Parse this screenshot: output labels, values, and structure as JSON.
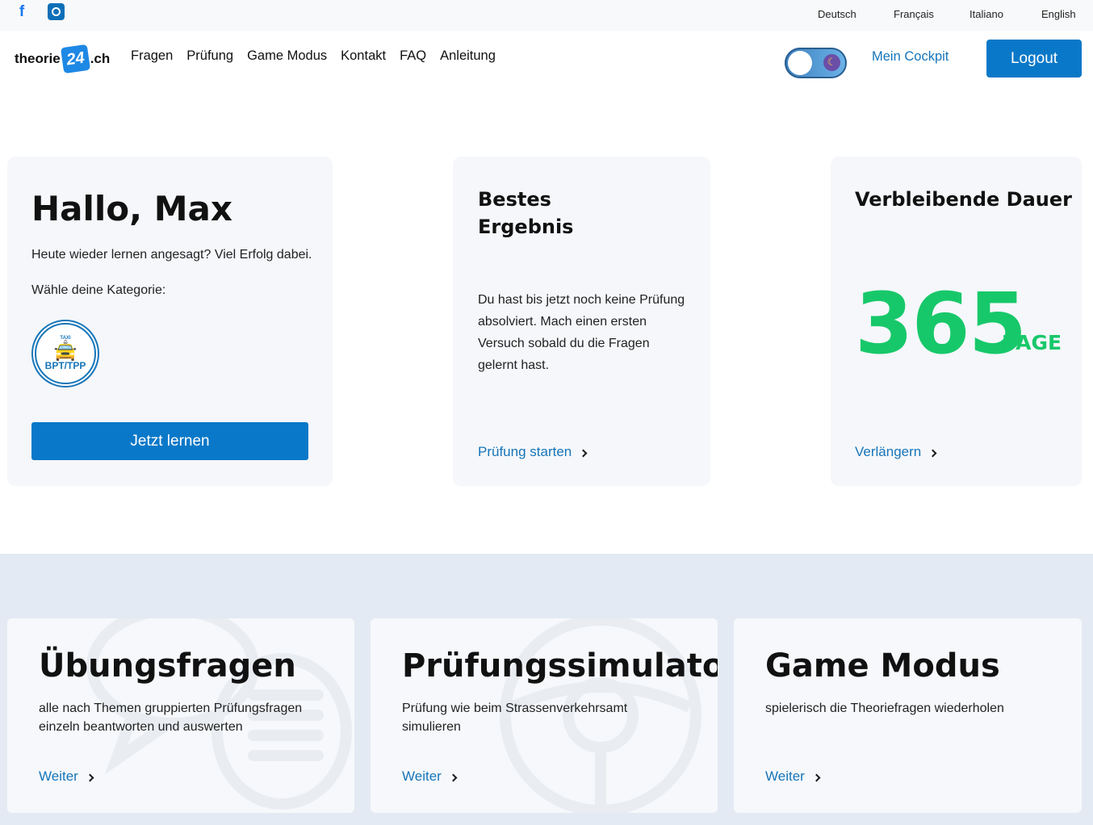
{
  "topbar": {
    "languages": [
      "Deutsch",
      "Français",
      "Italiano",
      "English"
    ]
  },
  "header": {
    "logo_prefix": "theorie",
    "logo_badge": "24",
    "logo_suffix": ".ch",
    "nav": [
      "Fragen",
      "Prüfung",
      "Game Modus",
      "Kontakt",
      "FAQ",
      "Anleitung"
    ],
    "cockpit_label": "Mein Cockpit",
    "logout_label": "Logout"
  },
  "welcome": {
    "greeting": "Hallo, Max",
    "subtitle": "Heute wieder lernen angesagt? Viel Erfolg dabei.",
    "category_prompt": "Wähle deine Kategorie:",
    "category_badge_top": "TAXI",
    "category_label": "BPT/TPP",
    "learn_button": "Jetzt lernen"
  },
  "best_result": {
    "title_line1": "Bestes",
    "title_line2": "Ergebnis",
    "text": "Du hast bis jetzt noch keine Prüfung absolviert. Mach einen ersten Versuch sobald du die Fragen gelernt hast.",
    "link": "Prüfung starten"
  },
  "remaining": {
    "title": "Verbleibende Dauer",
    "days": "365",
    "unit": "TAGE",
    "link": "Verlängern"
  },
  "features": [
    {
      "title": "Übungsfragen",
      "desc": "alle nach Themen gruppierten Prüfungsfragen einzeln beantworten und auswerten",
      "link": "Weiter"
    },
    {
      "title": "Prüfungssimulator",
      "desc": "Prüfung wie beim Strassenverkehrsamt simulieren",
      "link": "Weiter"
    },
    {
      "title": "Game Modus",
      "desc": "spielerisch die Theoriefragen wiederholen",
      "link": "Weiter"
    }
  ],
  "colors": {
    "primary": "#0a78c8",
    "link": "#1675b9",
    "accent_green": "#17c86a",
    "card_bg": "#f5f7fa",
    "section_bg": "#e4eaf3"
  },
  "icons": [
    "facebook-icon",
    "instagram-icon",
    "moon-icon",
    "taxi-icon",
    "chevron-right-icon",
    "chat-bubble-icon",
    "steering-wheel-icon"
  ]
}
